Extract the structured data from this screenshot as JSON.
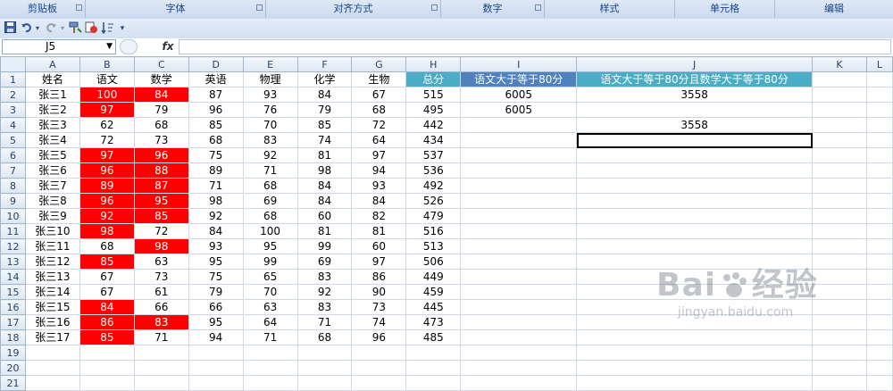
{
  "ribbon": {
    "groups": [
      "剪贴板",
      "字体",
      "对齐方式",
      "数字",
      "样式",
      "单元格",
      "编辑"
    ]
  },
  "qat": {
    "icons": [
      "save-icon",
      "undo-icon",
      "redo-icon",
      "format-painter-icon",
      "spell-icon",
      "sort-icon",
      "customize-icon"
    ]
  },
  "formula_bar": {
    "name_box": "J5",
    "fx": "fx",
    "formula": ""
  },
  "columns": [
    "A",
    "B",
    "C",
    "D",
    "E",
    "F",
    "G",
    "H",
    "I",
    "J",
    "K",
    "L"
  ],
  "header_row": [
    "姓名",
    "语文",
    "数学",
    "英语",
    "物理",
    "化学",
    "生物",
    "总分",
    "语文大于等于80分",
    "语文大于等于80分且数学大于等于80分"
  ],
  "rows": [
    [
      "张三1",
      "100",
      "84",
      "87",
      "93",
      "84",
      "67",
      "515",
      "6005",
      "3558"
    ],
    [
      "张三2",
      "97",
      "79",
      "96",
      "76",
      "79",
      "68",
      "495",
      "6005",
      ""
    ],
    [
      "张三3",
      "62",
      "68",
      "85",
      "70",
      "85",
      "72",
      "442",
      "",
      "3558"
    ],
    [
      "张三4",
      "72",
      "73",
      "68",
      "83",
      "74",
      "64",
      "434",
      "",
      ""
    ],
    [
      "张三5",
      "97",
      "96",
      "75",
      "92",
      "81",
      "97",
      "537",
      "",
      ""
    ],
    [
      "张三6",
      "96",
      "88",
      "89",
      "71",
      "98",
      "94",
      "536",
      "",
      ""
    ],
    [
      "张三7",
      "89",
      "87",
      "71",
      "68",
      "84",
      "93",
      "492",
      "",
      ""
    ],
    [
      "张三8",
      "96",
      "95",
      "98",
      "69",
      "84",
      "84",
      "526",
      "",
      ""
    ],
    [
      "张三9",
      "92",
      "85",
      "92",
      "68",
      "60",
      "82",
      "479",
      "",
      ""
    ],
    [
      "张三10",
      "98",
      "72",
      "84",
      "100",
      "81",
      "81",
      "516",
      "",
      ""
    ],
    [
      "张三11",
      "68",
      "98",
      "93",
      "95",
      "99",
      "60",
      "513",
      "",
      ""
    ],
    [
      "张三12",
      "85",
      "63",
      "95",
      "99",
      "69",
      "97",
      "506",
      "",
      ""
    ],
    [
      "张三13",
      "67",
      "73",
      "75",
      "65",
      "83",
      "86",
      "449",
      "",
      ""
    ],
    [
      "张三14",
      "67",
      "61",
      "79",
      "70",
      "92",
      "90",
      "459",
      "",
      ""
    ],
    [
      "张三15",
      "84",
      "66",
      "66",
      "63",
      "83",
      "73",
      "445",
      "",
      ""
    ],
    [
      "张三16",
      "86",
      "83",
      "95",
      "64",
      "71",
      "74",
      "473",
      "",
      ""
    ],
    [
      "张三17",
      "85",
      "71",
      "94",
      "71",
      "68",
      "96",
      "485",
      "",
      ""
    ]
  ],
  "red_cells": {
    "B": [
      2,
      3,
      6,
      7,
      8,
      9,
      10,
      11,
      13,
      16,
      17,
      18
    ],
    "C": [
      2,
      6,
      7,
      8,
      9,
      10,
      12,
      17
    ]
  },
  "selected_cell": "J5",
  "watermark": {
    "brand": "Bai",
    "brand2": "经验",
    "url": "jingyan.baidu.com"
  },
  "colors": {
    "red_fill": "#ff0000",
    "header_I": "#4f81bd",
    "header_J": "#4bacc6",
    "selection": "#000000"
  }
}
